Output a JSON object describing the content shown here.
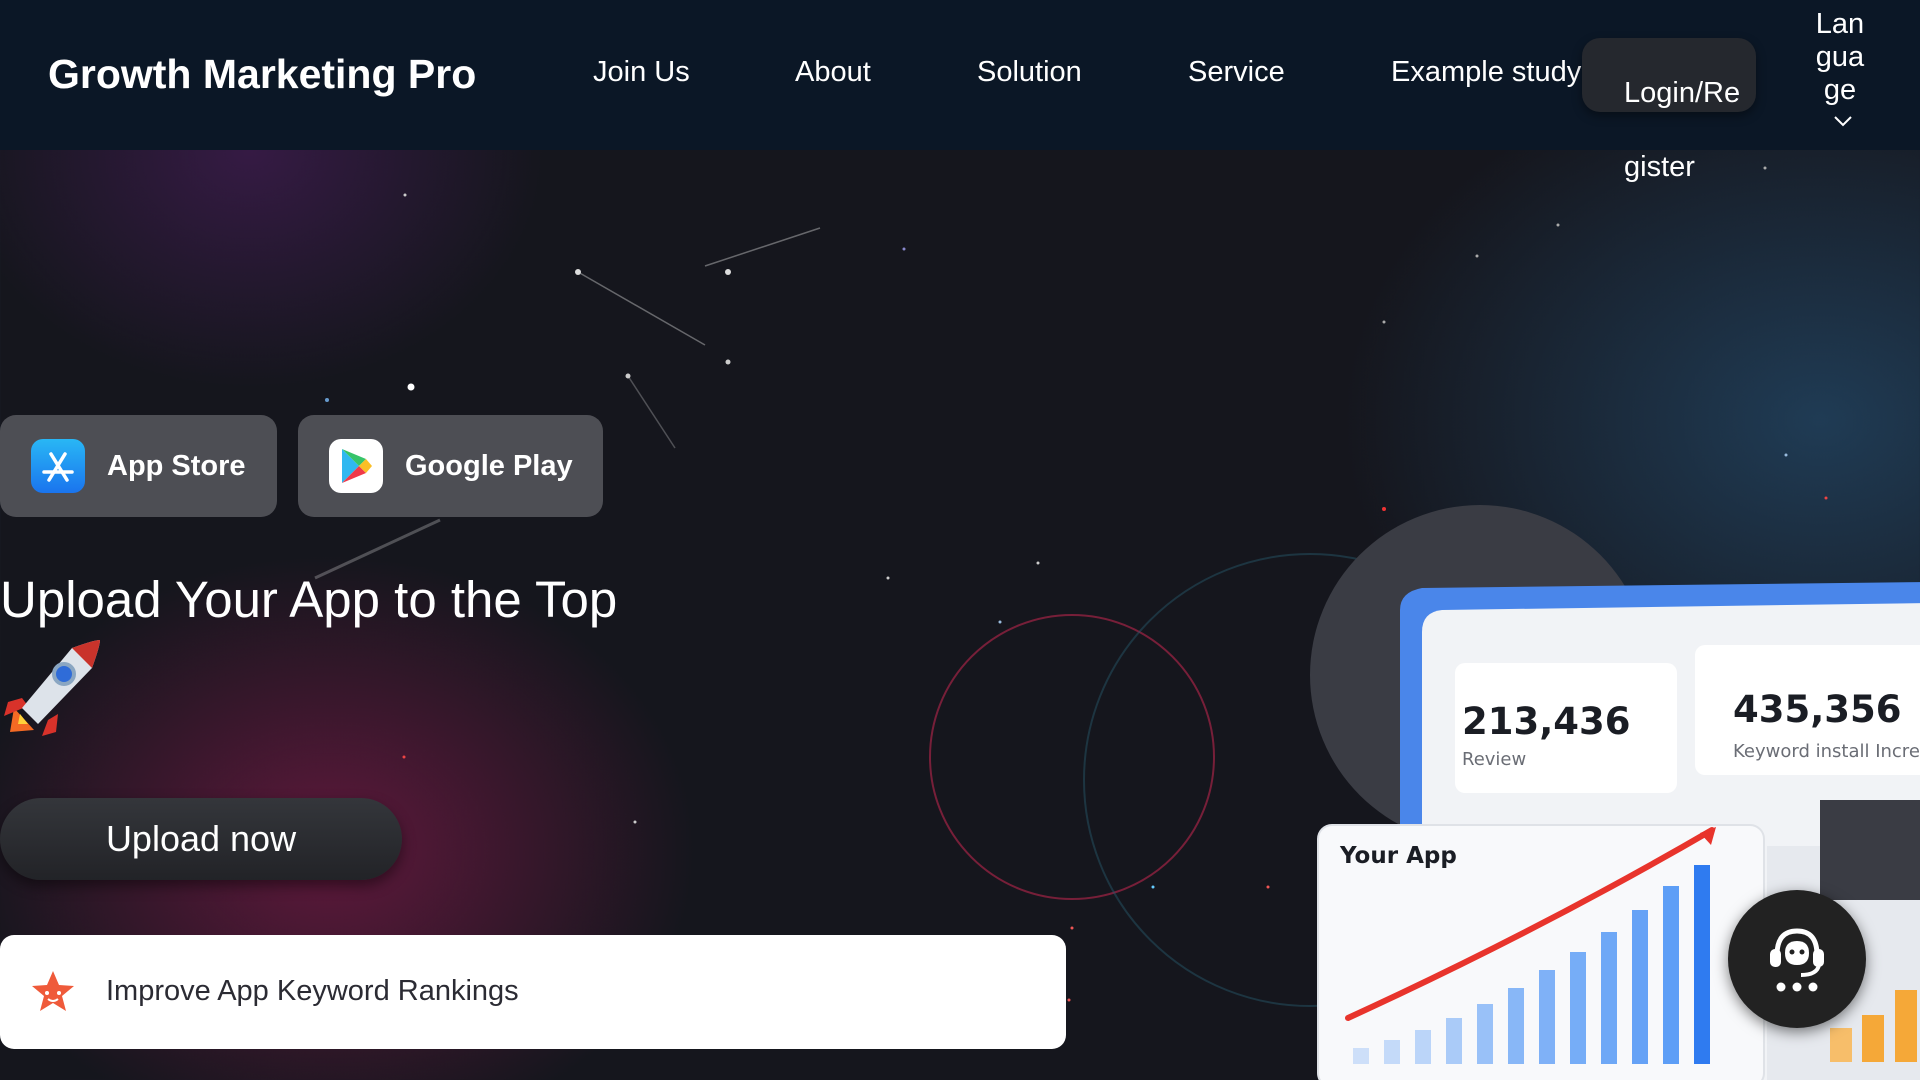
{
  "header": {
    "brand": "Growth Marketing Pro",
    "nav": [
      "Join Us",
      "About",
      "Solution",
      "Service",
      "Example study"
    ],
    "login_label": "Login/Register",
    "language_label": "Language"
  },
  "hero": {
    "app_store_label": "App Store",
    "google_play_label": "Google Play",
    "title": "Upload Your App to the Top",
    "upload_label": "Upload now",
    "feature_label": "Improve App Keyword Rankings"
  },
  "dashboard": {
    "review_value": "213,436",
    "review_label": "Review",
    "keyword_value": "435,356",
    "keyword_label": "Keyword install Incre",
    "chart_title": "Your App"
  },
  "icons": {
    "app_store": "app-store-icon",
    "google_play": "google-play-icon",
    "rocket": "rocket-icon",
    "star": "star-icon",
    "support": "headset-icon",
    "chevron": "chevron-down-icon"
  },
  "colors": {
    "nav_bg": "#0b1726",
    "button_bg": "#4d4e54",
    "accent_blue": "#2f7bf0",
    "accent_red": "#e8342c"
  }
}
